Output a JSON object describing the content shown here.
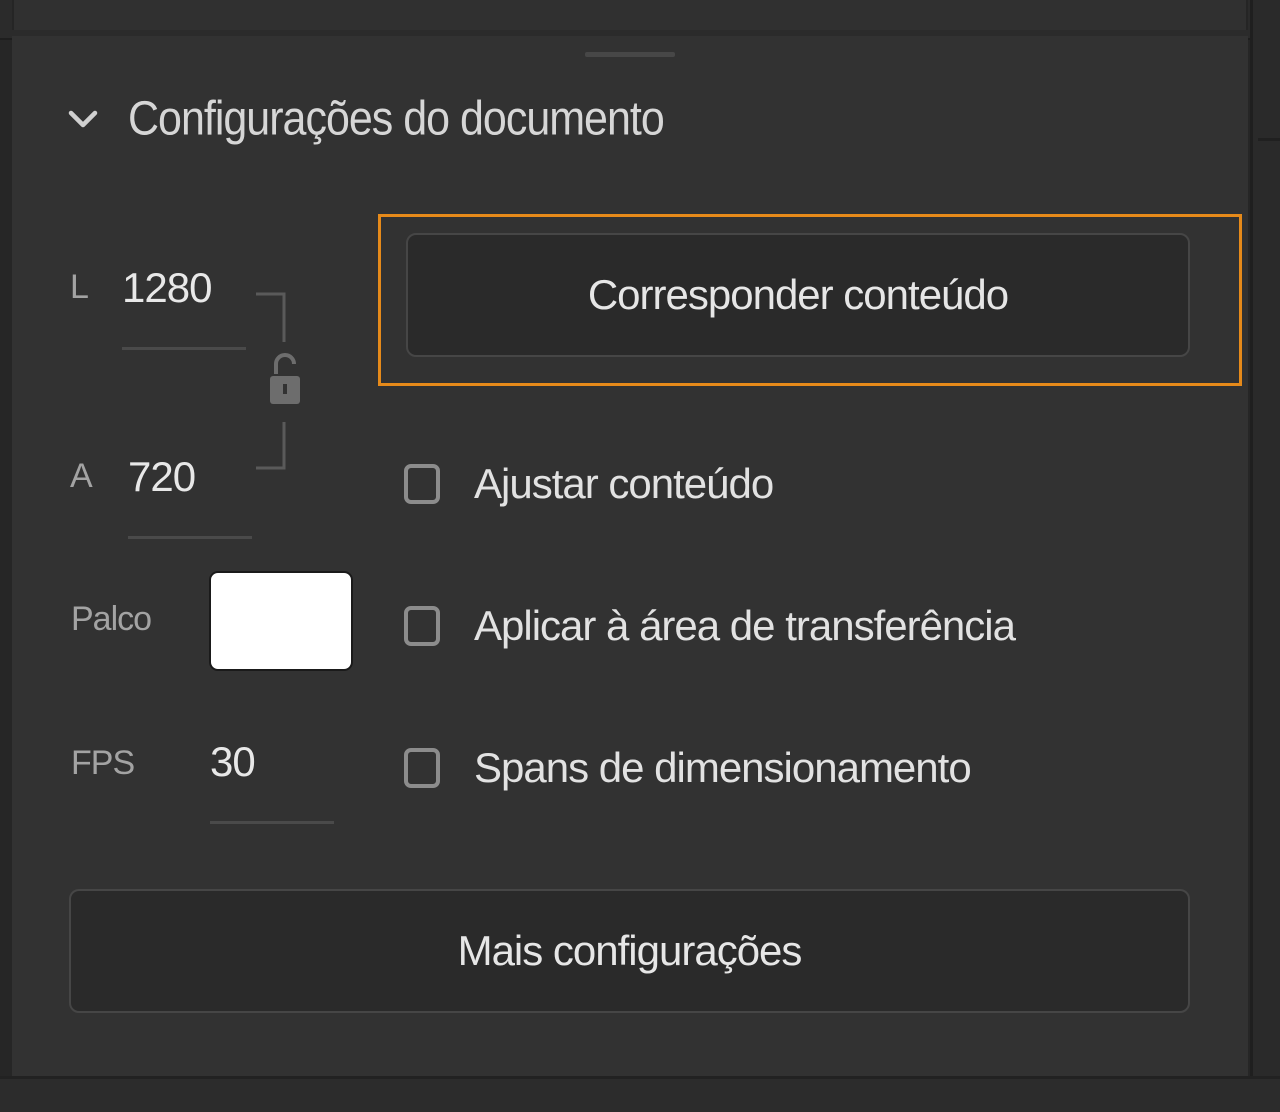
{
  "section": {
    "title": "Configurações do documento"
  },
  "dimensions": {
    "width_label": "L",
    "width_value": "1280",
    "height_label": "A",
    "height_value": "720"
  },
  "stage": {
    "label": "Palco",
    "color": "#ffffff"
  },
  "fps": {
    "label": "FPS",
    "value": "30"
  },
  "match_button": {
    "label": "Corresponder conteúdo"
  },
  "checkboxes": [
    {
      "label": "Ajustar conteúdo",
      "checked": false
    },
    {
      "label": "Aplicar à área de transferência",
      "checked": false
    },
    {
      "label": "Spans de dimensionamento",
      "checked": false
    }
  ],
  "more_button": {
    "label": "Mais configurações"
  },
  "colors": {
    "highlight": "#e68a1a",
    "panel": "#323232"
  }
}
